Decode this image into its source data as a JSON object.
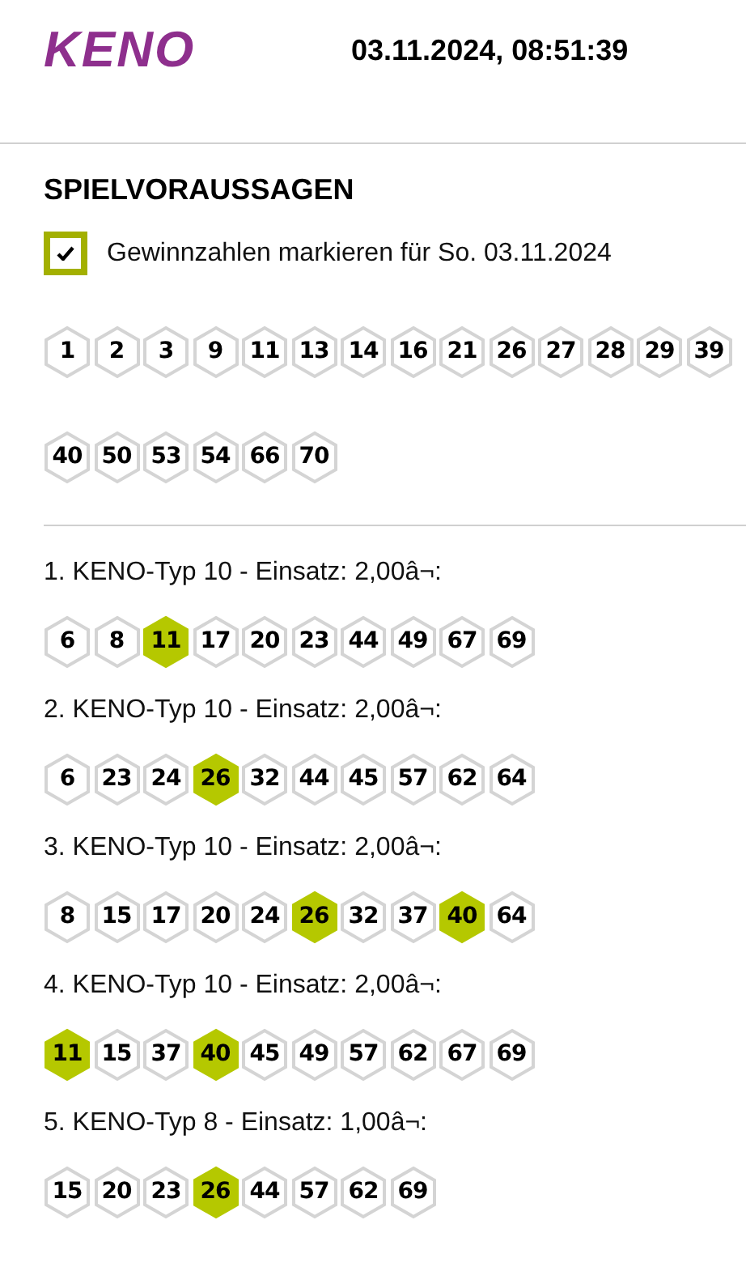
{
  "header": {
    "logo": "KENO",
    "datetime": "03.11.2024, 08:51:39"
  },
  "section": {
    "title": "SPIELVORAUSSAGEN",
    "option": {
      "label": "Gewinnzahlen markieren für So. 03.11.2024",
      "checked": true
    }
  },
  "numbers": [
    "1",
    "2",
    "3",
    "9",
    "11",
    "13",
    "14",
    "16",
    "21",
    "26",
    "27",
    "28",
    "29",
    "39",
    "40",
    "50",
    "53",
    "54",
    "66",
    "70"
  ],
  "tips": [
    {
      "label": "1. KENO-Typ 10 - Einsatz: 2,00â¬:",
      "numbers": [
        {
          "value": "6",
          "hit": false
        },
        {
          "value": "8",
          "hit": false
        },
        {
          "value": "11",
          "hit": true
        },
        {
          "value": "17",
          "hit": false
        },
        {
          "value": "20",
          "hit": false
        },
        {
          "value": "23",
          "hit": false
        },
        {
          "value": "44",
          "hit": false
        },
        {
          "value": "49",
          "hit": false
        },
        {
          "value": "67",
          "hit": false
        },
        {
          "value": "69",
          "hit": false
        }
      ]
    },
    {
      "label": "2. KENO-Typ 10 - Einsatz: 2,00â¬:",
      "numbers": [
        {
          "value": "6",
          "hit": false
        },
        {
          "value": "23",
          "hit": false
        },
        {
          "value": "24",
          "hit": false
        },
        {
          "value": "26",
          "hit": true
        },
        {
          "value": "32",
          "hit": false
        },
        {
          "value": "44",
          "hit": false
        },
        {
          "value": "45",
          "hit": false
        },
        {
          "value": "57",
          "hit": false
        },
        {
          "value": "62",
          "hit": false
        },
        {
          "value": "64",
          "hit": false
        }
      ]
    },
    {
      "label": "3. KENO-Typ 10 - Einsatz: 2,00â¬:",
      "numbers": [
        {
          "value": "8",
          "hit": false
        },
        {
          "value": "15",
          "hit": false
        },
        {
          "value": "17",
          "hit": false
        },
        {
          "value": "20",
          "hit": false
        },
        {
          "value": "24",
          "hit": false
        },
        {
          "value": "26",
          "hit": true
        },
        {
          "value": "32",
          "hit": false
        },
        {
          "value": "37",
          "hit": false
        },
        {
          "value": "40",
          "hit": true
        },
        {
          "value": "64",
          "hit": false
        }
      ]
    },
    {
      "label": "4. KENO-Typ 10 - Einsatz: 2,00â¬:",
      "numbers": [
        {
          "value": "11",
          "hit": true
        },
        {
          "value": "15",
          "hit": false
        },
        {
          "value": "37",
          "hit": false
        },
        {
          "value": "40",
          "hit": true
        },
        {
          "value": "45",
          "hit": false
        },
        {
          "value": "49",
          "hit": false
        },
        {
          "value": "57",
          "hit": false
        },
        {
          "value": "62",
          "hit": false
        },
        {
          "value": "67",
          "hit": false
        },
        {
          "value": "69",
          "hit": false
        }
      ]
    },
    {
      "label": "5. KENO-Typ 8 - Einsatz: 1,00â¬:",
      "numbers": [
        {
          "value": "15",
          "hit": false
        },
        {
          "value": "20",
          "hit": false
        },
        {
          "value": "23",
          "hit": false
        },
        {
          "value": "26",
          "hit": true
        },
        {
          "value": "44",
          "hit": false
        },
        {
          "value": "57",
          "hit": false
        },
        {
          "value": "62",
          "hit": false
        },
        {
          "value": "69",
          "hit": false
        }
      ]
    }
  ]
}
